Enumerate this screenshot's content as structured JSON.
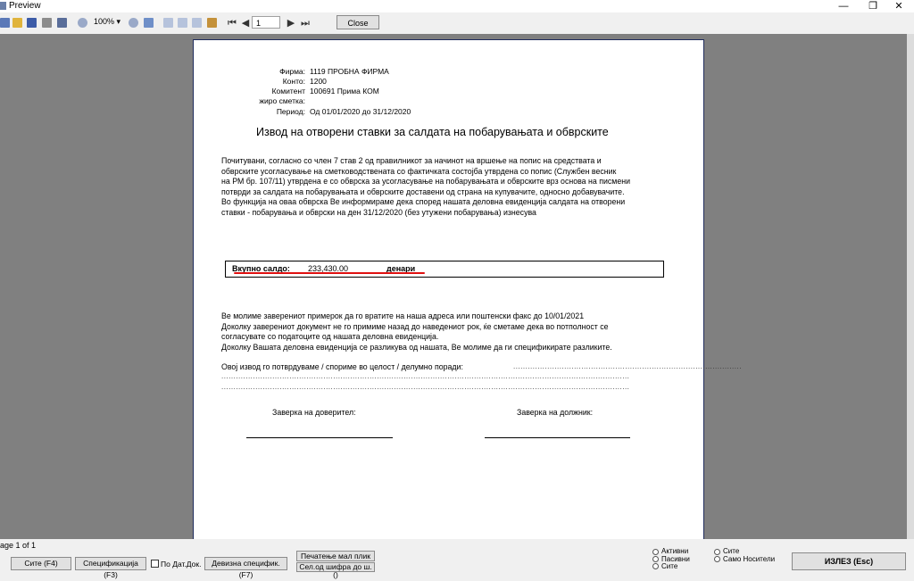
{
  "window": {
    "title": "Preview",
    "minimize": "—",
    "maximize": "❐",
    "close": "✕"
  },
  "toolbar": {
    "zoom": "100%",
    "zoom_arrow": "▾",
    "first": "⏮",
    "prev": "◀",
    "page_value": "1",
    "next": "▶",
    "last": "⏭",
    "close_label": "Close"
  },
  "doc": {
    "header": {
      "firma_label": "Фирма:",
      "firma_value": "1119 ПРОБНА ФИРМА",
      "konto_label": "Конто:",
      "konto_value": "1200",
      "komitent_label": "Комитент",
      "komitent_value": "100691  Прима КОМ",
      "ziro_label": "жиро сметка:",
      "ziro_value": "",
      "period_label": "Период:",
      "period_value": "Од 01/01/2020 до 31/12/2020"
    },
    "title": "Извод на отворени ставки за салдата на побарувањата и обврските",
    "para1": [
      "Почитувани, согласно со член 7 став 2 од правилникот за начинот на вршење на попис на средствата и",
      "обврските усогласување на сметководствената со фактичката состојба утврдена со попис (Службен весник",
      "на РМ бр. 107/11) утврдена е со обврска за усогласување на побарувањата и обврските врз основа на писмени",
      "потврди за салдата на побарувањата и обврските доставени од страна на купувачите, односно добавувачите.",
      "Во функција на оваа обврска Ве информираме дека според нашата деловна евиденција салдата на отворени",
      "ставки - побарувања и обврски на ден   31/12/2020     (без утужени побарувања) изнесува"
    ],
    "sum_label": "Вкупно салдо:",
    "sum_value": "233,430.00",
    "sum_currency": "денари",
    "para2": [
      "Ве молиме заверениот примерок да го вратите на наша адреса или поштенски факс до     10/01/2021",
      "Доколку заверениот документ не го примиме назад до наведениот рок, ќе сметаме дека во потполност се",
      "согласувате со податоците од нашата деловна евиденција.",
      "Доколку Вашата деловна евиденција се разликува од нашата, Ве молиме да ги спецификирате разликите."
    ],
    "confirm_line": "Овој извод го потврдуваме / спориме во целост / делумно поради:",
    "dots1": "..............................................................................................",
    "dots2": "........................................................................................................................................................................",
    "dots3": "........................................................................................................................................................................",
    "creditor": "Заверка на доверител:",
    "debtor": "Заверка на должник:"
  },
  "status": {
    "page_info": "age 1 of 1",
    "btn_all": "Сите (F4)",
    "btn_spec": "Спецификација (F3)",
    "chk_po_dat": "По Дат.Док.",
    "btn_deviz": "Девизна специфик.(F7)",
    "btn_print": "Печатење мал плик",
    "btn_sel": "Сел.од шифра до ш. ()",
    "radio_active": "Активни",
    "radio_passive": "Пасивни",
    "radio_all": "Сите",
    "radio_all2": "Сите",
    "radio_carriers": "Само Носители",
    "btn_exit": "ИЗЛЕЗ   (Esc)"
  }
}
